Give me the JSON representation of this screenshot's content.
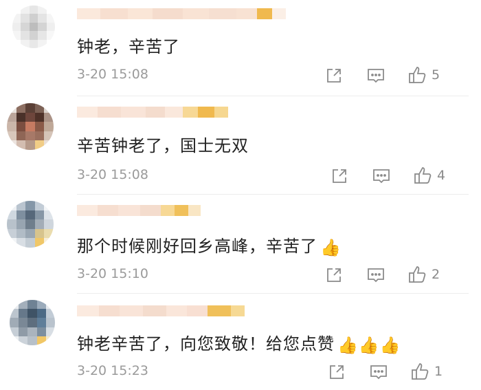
{
  "comments": [
    {
      "text": "钟老，辛苦了",
      "emoji": "",
      "time": "3-20 15:08",
      "likes": "5",
      "share_icon": "share-icon",
      "reply_icon": "comment-icon",
      "like_icon": "thumbs-up-icon"
    },
    {
      "text": "辛苦钟老了，国士无双",
      "emoji": "",
      "time": "3-20 15:08",
      "likes": "4",
      "share_icon": "share-icon",
      "reply_icon": "comment-icon",
      "like_icon": "thumbs-up-icon"
    },
    {
      "text": "那个时候刚好回乡高峰，辛苦了",
      "emoji": "👍",
      "time": "3-20 15:10",
      "likes": "2",
      "share_icon": "share-icon",
      "reply_icon": "comment-icon",
      "like_icon": "thumbs-up-icon"
    },
    {
      "text": "钟老辛苦了，向您致敬！给您点赞",
      "emoji": "👍👍👍",
      "time": "3-20 15:23",
      "likes": "1",
      "share_icon": "share-icon",
      "reply_icon": "comment-icon",
      "like_icon": "thumbs-up-icon"
    }
  ],
  "colors": {
    "text": "#222222",
    "meta": "#9a9a9a",
    "icon": "#8a8a8a",
    "mosaic_orange": "#f0b94e"
  }
}
